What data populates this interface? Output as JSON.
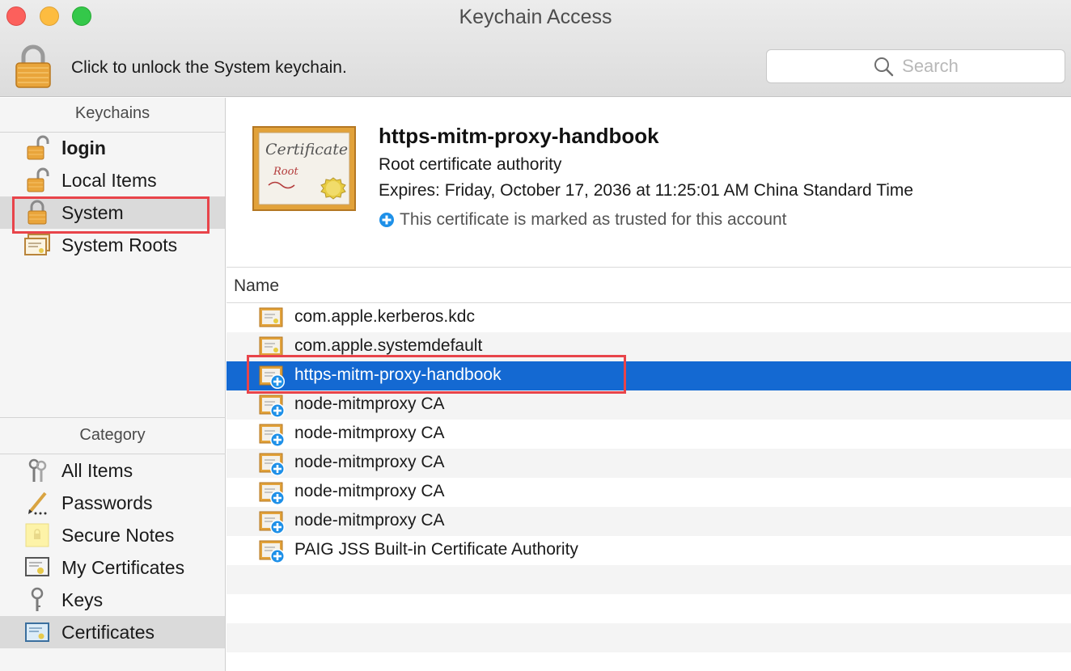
{
  "window": {
    "title": "Keychain Access"
  },
  "toolbar": {
    "unlock_text": "Click to unlock the System keychain.",
    "search_placeholder": "Search"
  },
  "sidebar": {
    "keychains_header": "Keychains",
    "keychains": [
      {
        "label": "login",
        "icon": "lock-open-icon"
      },
      {
        "label": "Local Items",
        "icon": "lock-open-icon"
      },
      {
        "label": "System",
        "icon": "lock-closed-icon",
        "selected": true
      },
      {
        "label": "System Roots",
        "icon": "certificates-stack-icon"
      }
    ],
    "category_header": "Category",
    "categories": [
      {
        "label": "All Items",
        "icon": "keys-icon"
      },
      {
        "label": "Passwords",
        "icon": "pencil-dots-icon"
      },
      {
        "label": "Secure Notes",
        "icon": "note-icon"
      },
      {
        "label": "My Certificates",
        "icon": "my-certificate-icon"
      },
      {
        "label": "Keys",
        "icon": "key-icon"
      },
      {
        "label": "Certificates",
        "icon": "certificate-icon",
        "selected": true
      }
    ]
  },
  "details": {
    "title": "https-mitm-proxy-handbook",
    "kind": "Root certificate authority",
    "expires": "Expires: Friday, October 17, 2036 at 11:25:01 AM China Standard Time",
    "trust": "This certificate is marked as trusted for this account",
    "cert_image": {
      "script_text": "Certificate",
      "sub_text": "Root"
    }
  },
  "table": {
    "column_name": "Name",
    "rows": [
      {
        "name": "com.apple.kerberos.kdc",
        "trusted_badge": false
      },
      {
        "name": "com.apple.systemdefault",
        "trusted_badge": false
      },
      {
        "name": "https-mitm-proxy-handbook",
        "trusted_badge": true,
        "selected": true
      },
      {
        "name": "node-mitmproxy CA",
        "trusted_badge": true
      },
      {
        "name": "node-mitmproxy CA",
        "trusted_badge": true
      },
      {
        "name": "node-mitmproxy CA",
        "trusted_badge": true
      },
      {
        "name": "node-mitmproxy CA",
        "trusted_badge": true
      },
      {
        "name": "node-mitmproxy CA",
        "trusted_badge": true
      },
      {
        "name": "PAIG JSS Built-in Certificate Authority",
        "trusted_badge": true
      }
    ]
  },
  "colors": {
    "selection": "#1469d2",
    "highlight_box": "#e8444a",
    "trust_badge": "#1e90e8"
  }
}
